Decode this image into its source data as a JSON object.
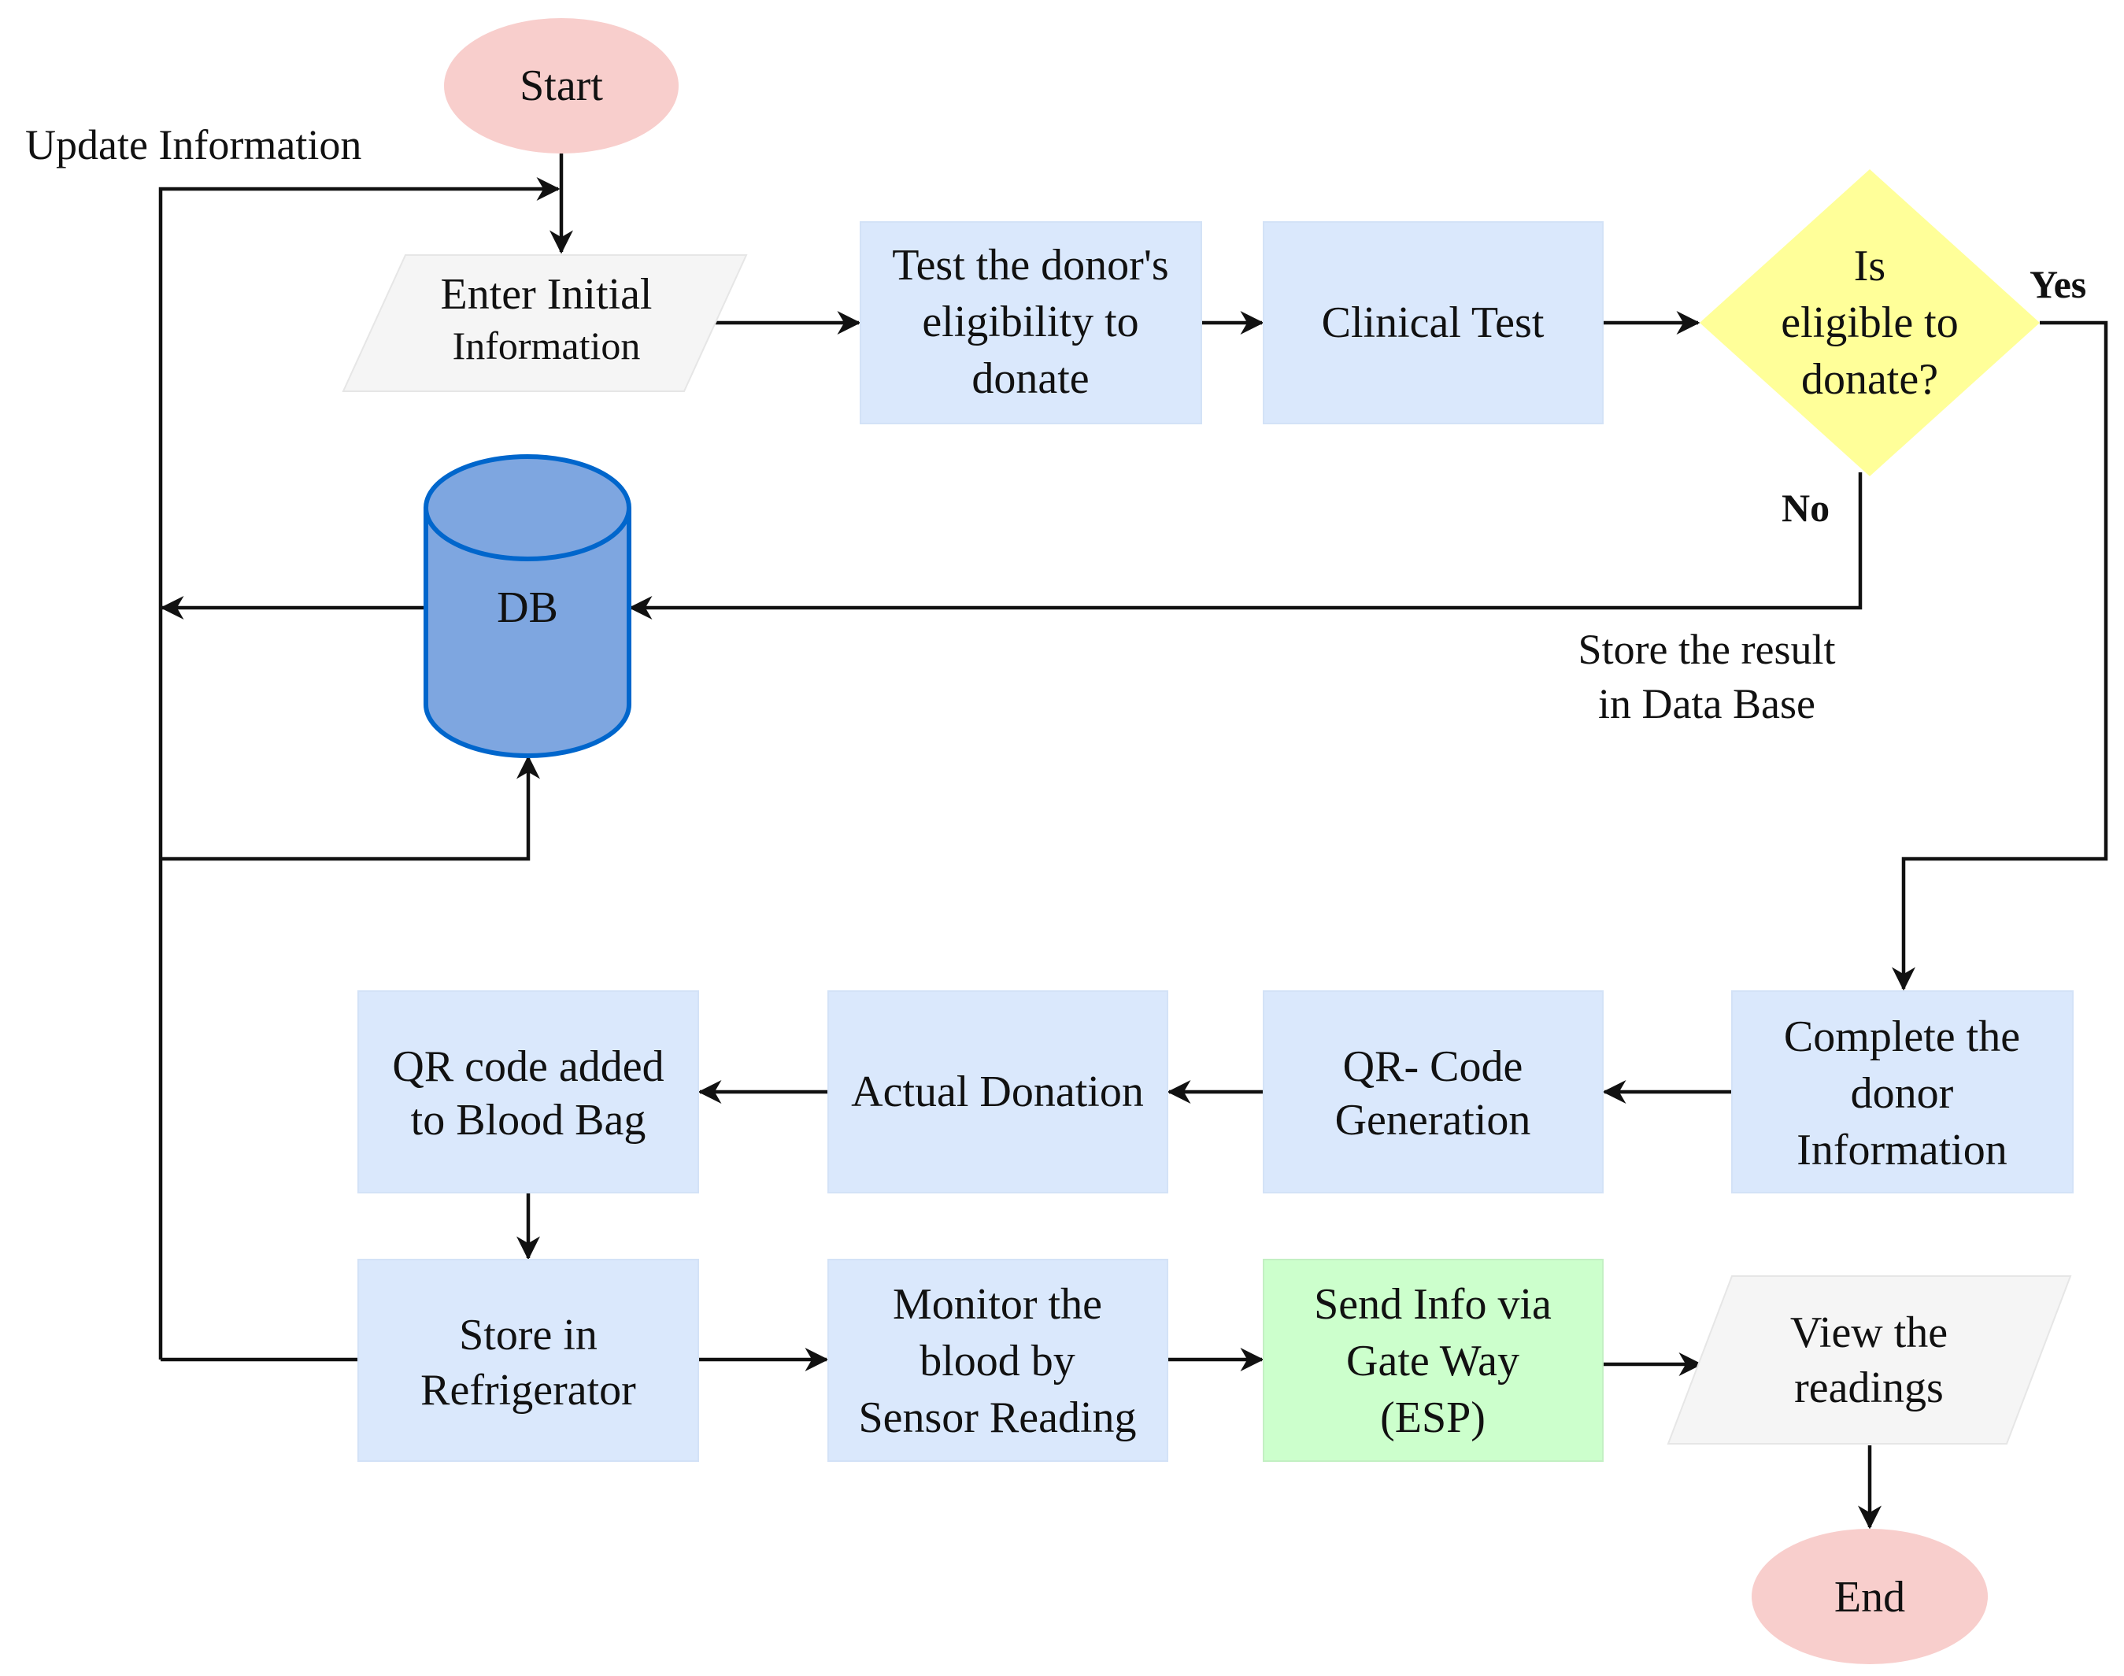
{
  "diagram": {
    "type": "flowchart",
    "colors": {
      "process_fill": "#dae8fc",
      "terminal_fill": "#f8cecc",
      "io_fill": "#f5f5f5",
      "decision_fill": "#ffff99",
      "db_fill": "#7ea6e0",
      "db_stroke": "#0066cc",
      "gateway_fill": "#ccffcc",
      "edge_color": "#111111"
    },
    "nodes": {
      "start": {
        "shape": "ellipse",
        "lines": [
          "Start"
        ]
      },
      "enter_initial": {
        "shape": "parallelogram",
        "lines": [
          "Enter Initial",
          "Information"
        ]
      },
      "test_eligibility": {
        "shape": "process",
        "lines": [
          "Test the donor's",
          "eligibility to",
          "donate"
        ]
      },
      "clinical_test": {
        "shape": "process",
        "lines": [
          "Clinical Test"
        ]
      },
      "is_eligible": {
        "shape": "decision",
        "lines": [
          "Is",
          "eligible to",
          "donate?"
        ]
      },
      "db": {
        "shape": "cylinder",
        "lines": [
          "DB"
        ]
      },
      "complete_info": {
        "shape": "process",
        "lines": [
          "Complete the",
          "donor",
          "Information"
        ]
      },
      "qr_generation": {
        "shape": "process",
        "lines": [
          "QR- Code",
          "Generation"
        ]
      },
      "actual_donation": {
        "shape": "process",
        "lines": [
          "Actual Donation"
        ]
      },
      "qr_added": {
        "shape": "process",
        "lines": [
          "QR code added",
          "to Blood Bag"
        ]
      },
      "store_fridge": {
        "shape": "process",
        "lines": [
          "Store in",
          "Refrigerator"
        ]
      },
      "monitor": {
        "shape": "process",
        "lines": [
          "Monitor the",
          "blood by",
          "Sensor Reading"
        ]
      },
      "send_gateway": {
        "shape": "process",
        "lines": [
          "Send Info via",
          "Gate Way",
          "(ESP)"
        ]
      },
      "view_readings": {
        "shape": "parallelogram",
        "lines": [
          "View the",
          "readings"
        ]
      },
      "end": {
        "shape": "ellipse",
        "lines": [
          "End"
        ]
      }
    },
    "edges": [
      {
        "from": "start",
        "to": "enter_initial",
        "label": ""
      },
      {
        "from": "enter_initial",
        "to": "test_eligibility",
        "label": ""
      },
      {
        "from": "test_eligibility",
        "to": "clinical_test",
        "label": ""
      },
      {
        "from": "clinical_test",
        "to": "is_eligible",
        "label": ""
      },
      {
        "from": "is_eligible",
        "to": "complete_info",
        "label": "Yes"
      },
      {
        "from": "is_eligible",
        "to": "db",
        "label": "No"
      },
      {
        "from": "db",
        "to": "enter_initial",
        "label": "Update Information"
      },
      {
        "from": "complete_info",
        "to": "qr_generation",
        "label": ""
      },
      {
        "from": "qr_generation",
        "to": "actual_donation",
        "label": ""
      },
      {
        "from": "actual_donation",
        "to": "qr_added",
        "label": ""
      },
      {
        "from": "qr_added",
        "to": "store_fridge",
        "label": ""
      },
      {
        "from": "store_fridge",
        "to": "monitor",
        "label": ""
      },
      {
        "from": "store_fridge",
        "to": "db",
        "label": ""
      },
      {
        "from": "monitor",
        "to": "send_gateway",
        "label": ""
      },
      {
        "from": "send_gateway",
        "to": "view_readings",
        "label": ""
      },
      {
        "from": "view_readings",
        "to": "end",
        "label": ""
      }
    ],
    "labels": {
      "update_information": "Update Information",
      "yes": "Yes",
      "no": "No",
      "store_result_line1": "Store the result",
      "store_result_line2": "in Data Base"
    }
  }
}
